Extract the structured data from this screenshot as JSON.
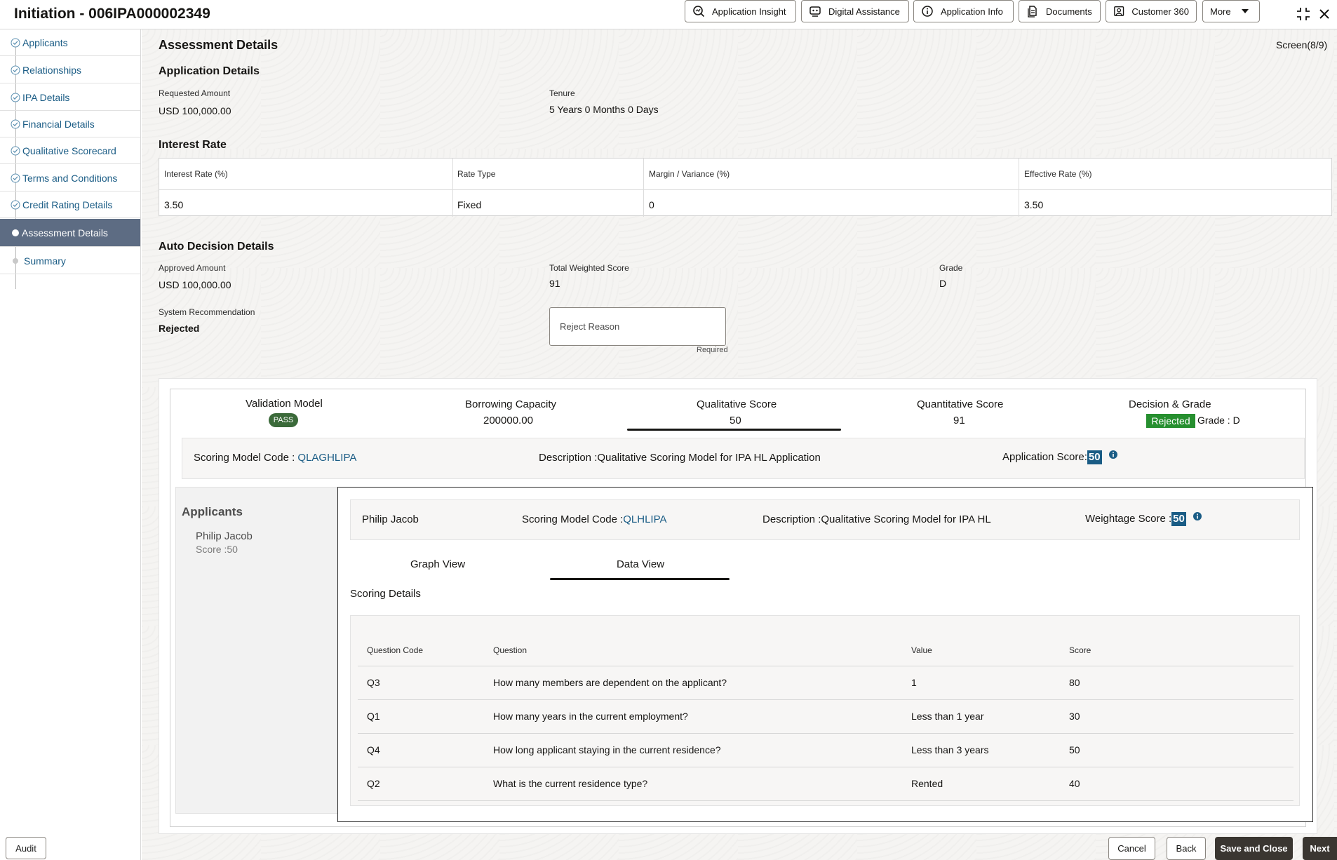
{
  "header": {
    "title": "Initiation - 006IPA000002349",
    "buttons": [
      {
        "label": "Application Insight",
        "icon": "insight-icon"
      },
      {
        "label": "Digital Assistance",
        "icon": "assistant-icon"
      },
      {
        "label": "Application Info",
        "icon": "info-icon"
      },
      {
        "label": "Documents",
        "icon": "documents-icon"
      },
      {
        "label": "Customer 360",
        "icon": "customer-icon"
      },
      {
        "label": "More",
        "icon": "chevron-down-icon"
      }
    ]
  },
  "sidebar": {
    "items": [
      {
        "label": "Applicants",
        "state": "done"
      },
      {
        "label": "Relationships",
        "state": "done"
      },
      {
        "label": "IPA Details",
        "state": "done"
      },
      {
        "label": "Financial Details",
        "state": "done"
      },
      {
        "label": "Qualitative Scorecard",
        "state": "done"
      },
      {
        "label": "Terms and Conditions",
        "state": "done"
      },
      {
        "label": "Credit Rating Details",
        "state": "done"
      },
      {
        "label": "Assessment Details",
        "state": "active"
      },
      {
        "label": "Summary",
        "state": "pending"
      }
    ],
    "audit_label": "Audit"
  },
  "page": {
    "title": "Assessment Details",
    "screen_counter": "Screen(8/9)"
  },
  "application_details": {
    "heading": "Application Details",
    "requested_amount_label": "Requested Amount",
    "requested_amount": "USD 100,000.00",
    "tenure_label": "Tenure",
    "tenure": "5 Years 0 Months 0 Days"
  },
  "interest_rate": {
    "heading": "Interest Rate",
    "columns": [
      "Interest Rate (%)",
      "Rate Type",
      "Margin / Variance (%)",
      "Effective Rate (%)"
    ],
    "values": [
      "3.50",
      "Fixed",
      "0",
      "3.50"
    ]
  },
  "auto_decision": {
    "heading": "Auto Decision Details",
    "approved_amount_label": "Approved Amount",
    "approved_amount": "USD 100,000.00",
    "total_weighted_score_label": "Total Weighted Score",
    "total_weighted_score": "91",
    "grade_label": "Grade",
    "grade": "D",
    "system_recommendation_label": "System Recommendation",
    "system_recommendation": "Rejected",
    "reject_reason_placeholder": "Reject Reason",
    "required_text": "Required"
  },
  "summary_tabs": {
    "validation_model_label": "Validation Model",
    "validation_model_badge": "PASS",
    "borrowing_capacity_label": "Borrowing Capacity",
    "borrowing_capacity": "200000.00",
    "qualitative_score_label": "Qualitative Score",
    "qualitative_score": "50",
    "quantitative_score_label": "Quantitative Score",
    "quantitative_score": "91",
    "decision_grade_label": "Decision & Grade",
    "decision_badge": "Rejected",
    "grade_text": "Grade : D"
  },
  "scoring_model": {
    "code_label": "Scoring Model Code : ",
    "code": "QLAGHLIPA",
    "description": "Description :Qualitative Scoring Model for IPA HL Application",
    "app_score_label": "Application Score:",
    "app_score": "50"
  },
  "applicants_panel": {
    "heading": "Applicants",
    "name": "Philip Jacob",
    "score": "Score :50"
  },
  "applicant_detail": {
    "name": "Philip Jacob",
    "code_label": "Scoring Model Code :",
    "code": "QLHLIPA",
    "description": "Description :Qualitative Scoring Model for IPA HL",
    "weightage_label": "Weightage Score :",
    "weightage": "50",
    "tabs": [
      "Graph View",
      "Data View"
    ],
    "section_title": "Scoring Details"
  },
  "scoring_table": {
    "columns": [
      "Question Code",
      "Question",
      "Value",
      "Score"
    ],
    "rows": [
      [
        "Q3",
        "How many members are dependent on the applicant?",
        "1",
        "80"
      ],
      [
        "Q1",
        "How many years in the current employment?",
        "Less than 1 year",
        "30"
      ],
      [
        "Q4",
        "How long applicant staying in the current residence?",
        "Less than 3 years",
        "50"
      ],
      [
        "Q2",
        "What is the current residence type?",
        "Rented",
        "40"
      ]
    ]
  },
  "footer": {
    "cancel": "Cancel",
    "back": "Back",
    "save_close": "Save and Close",
    "next": "Next"
  },
  "colors": {
    "link": "#1a5c85",
    "active_nav": "#5d6c83",
    "pass_badge": "#3b6a3a",
    "rejected_badge": "#268f2f",
    "score_chip": "#1a5c85"
  }
}
